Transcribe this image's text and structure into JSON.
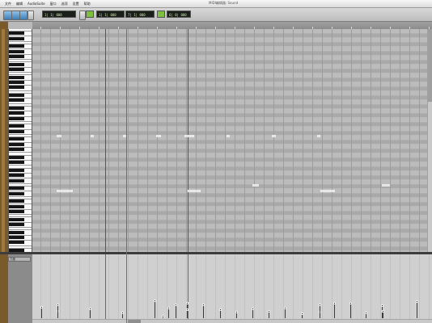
{
  "menu": {
    "items": [
      "文件",
      "编辑",
      "AudioSuite",
      "窗口",
      "选项",
      "设置",
      "帮助"
    ],
    "window_title": "MIDI编辑器: Sound"
  },
  "toolbar": {
    "counter": "1| 1| 000",
    "start": "1| 1| 000",
    "end": "7| 1| 000",
    "length": "6| 0| 000"
  },
  "lane": {
    "selector": "力度"
  },
  "colors": {
    "keyboard_white": "#fafafa",
    "keyboard_black": "#151515",
    "lcd_green": "#7fbf3f",
    "track_strip": "#7a5a2a",
    "bar_line": "#575757"
  }
}
